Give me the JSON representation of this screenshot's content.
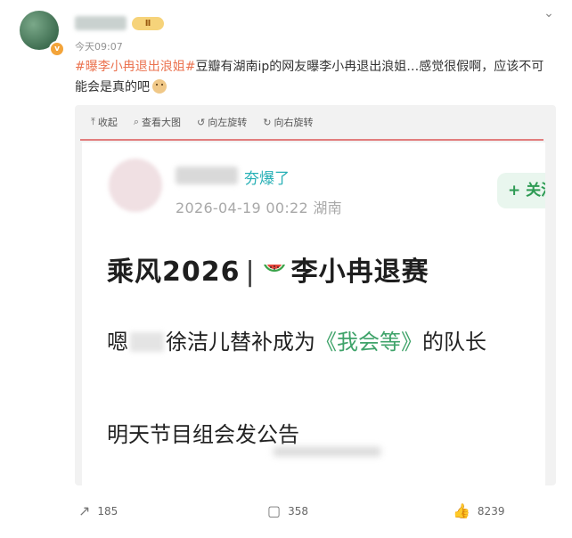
{
  "post": {
    "time": "今天09:07",
    "vip_label": "Ⅱ",
    "text_tag": "#曝李小冉退出浪姐#",
    "text_body": "豆瓣有湖南ip的网友曝李小冉退出浪姐…感觉很假啊，应该不可能会是真的吧"
  },
  "toolbar": {
    "collapse": "收起",
    "view_large": "查看大图",
    "rotate_left": "向左旋转",
    "rotate_right": "向右旋转"
  },
  "screenshot": {
    "badge": "夯爆了",
    "date": "2026-04-19 00:22 湖南",
    "follow": "+ 关注",
    "title_prefix": "乘风2026",
    "title_sep": "|",
    "title_suffix": "李小冉退赛",
    "line1_a": "嗯",
    "line1_b": "徐洁儿替补成为",
    "line1_c": "《我会等》",
    "line1_d": "的队长",
    "line2": "明天节目组会发公告"
  },
  "actions": {
    "share_count": "185",
    "comment_count": "358",
    "like_count": "8239"
  },
  "colors": {
    "tag": "#eb7350",
    "accent_green": "#3fa36a",
    "badge_teal": "#28b0b6"
  }
}
